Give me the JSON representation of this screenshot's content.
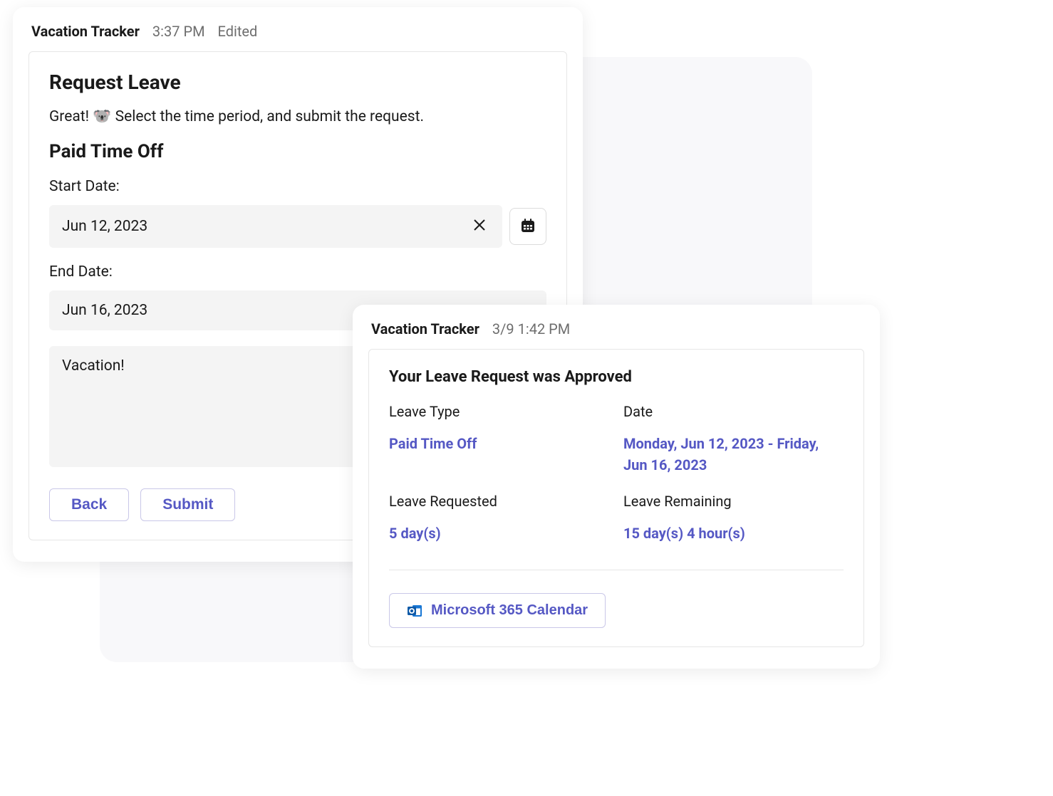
{
  "request_card": {
    "app_name": "Vacation Tracker",
    "timestamp": "3:37 PM",
    "edited_label": "Edited",
    "title": "Request Leave",
    "subtitle": "Great! 🐨 Select the time period, and submit the request.",
    "leave_type": "Paid Time Off",
    "start_date_label": "Start Date:",
    "start_date_value": "Jun 12, 2023",
    "end_date_label": "End Date:",
    "end_date_value": "Jun 16, 2023",
    "note_value": "Vacation!",
    "back_label": "Back",
    "submit_label": "Submit"
  },
  "approved_card": {
    "app_name": "Vacation Tracker",
    "timestamp": "3/9 1:42 PM",
    "title": "Your Leave Request was Approved",
    "leave_type_label": "Leave Type",
    "leave_type_value": "Paid Time Off",
    "date_label": "Date",
    "date_value": "Monday, Jun 12, 2023 - Friday, Jun 16, 2023",
    "requested_label": "Leave Requested",
    "requested_value": "5 day(s)",
    "remaining_label": "Leave Remaining",
    "remaining_value": "15 day(s) 4 hour(s)",
    "calendar_button": "Microsoft 365 Calendar"
  }
}
